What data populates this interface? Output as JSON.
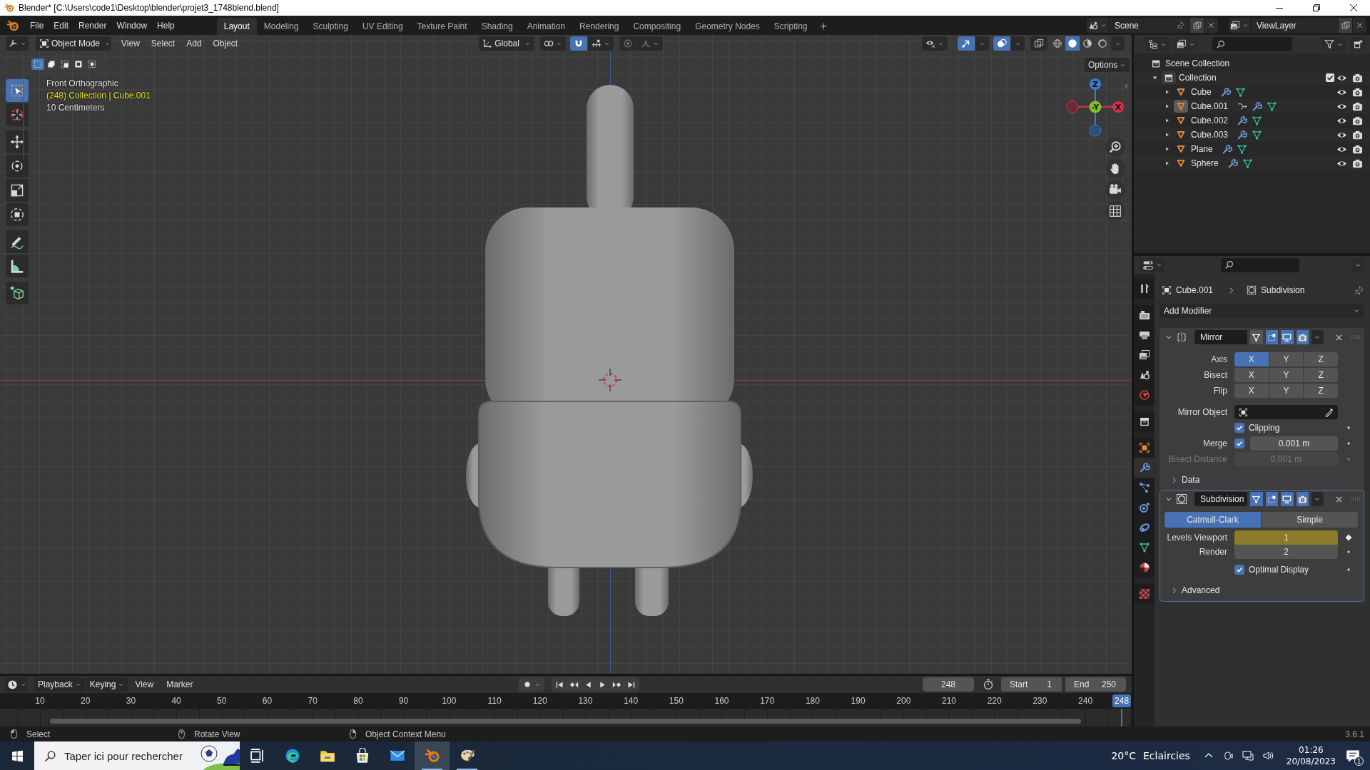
{
  "window": {
    "title": "Blender* [C:\\Users\\code1\\Desktop\\blender\\projet3_1748blend.blend]"
  },
  "menus": [
    "File",
    "Edit",
    "Render",
    "Window",
    "Help"
  ],
  "workspaces": [
    {
      "label": "Layout",
      "selected": true
    },
    {
      "label": "Modeling",
      "selected": false
    },
    {
      "label": "Sculpting",
      "selected": false
    },
    {
      "label": "UV Editing",
      "selected": false
    },
    {
      "label": "Texture Paint",
      "selected": false
    },
    {
      "label": "Shading",
      "selected": false
    },
    {
      "label": "Animation",
      "selected": false
    },
    {
      "label": "Rendering",
      "selected": false
    },
    {
      "label": "Compositing",
      "selected": false
    },
    {
      "label": "Geometry Nodes",
      "selected": false
    },
    {
      "label": "Scripting",
      "selected": false
    }
  ],
  "add_workspace": "+",
  "scene": "Scene",
  "view_layer": "ViewLayer",
  "viewport": {
    "mode": "Object Mode",
    "menus": [
      "View",
      "Select",
      "Add",
      "Object"
    ],
    "orientation": "Global",
    "snap": {
      "on": true
    },
    "gizmos": {
      "on": true
    },
    "overlays": {
      "on": true
    },
    "xray": {
      "on": false
    },
    "shading": [
      {
        "kind": "wireframe",
        "selected": false
      },
      {
        "kind": "solid",
        "selected": true
      },
      {
        "kind": "material",
        "selected": false
      },
      {
        "kind": "rendered",
        "selected": false
      }
    ],
    "select_modes": [
      {
        "selected": true
      },
      {
        "selected": false
      },
      {
        "selected": false
      },
      {
        "selected": false
      },
      {
        "selected": false
      }
    ],
    "options": "Options",
    "info": {
      "view": "Front Orthographic",
      "object": "(248) Collection | Cube.001",
      "scale": "10 Centimeters"
    },
    "tools": [
      [
        {
          "kind": "select",
          "selected": true
        },
        {
          "kind": "cursor",
          "selected": false
        }
      ],
      [
        {
          "kind": "move",
          "selected": false
        },
        {
          "kind": "rotate",
          "selected": false
        },
        {
          "kind": "scale",
          "selected": false
        },
        {
          "kind": "transform",
          "selected": false
        }
      ],
      [
        {
          "kind": "annotate",
          "selected": false
        },
        {
          "kind": "measure",
          "selected": false
        }
      ],
      [
        {
          "kind": "add-cube",
          "selected": false
        }
      ]
    ],
    "gizmo": {
      "z": "Z",
      "y": "-Y",
      "x": "X"
    }
  },
  "outliner": {
    "root": "Scene Collection",
    "collections": [
      {
        "label": "Collection",
        "expanded": true,
        "checked": true,
        "children": [
          {
            "label": "Cube",
            "selected": false,
            "expanded": false,
            "hook": false
          },
          {
            "label": "Cube.001",
            "selected": true,
            "expanded": false,
            "hook": true
          },
          {
            "label": "Cube.002",
            "selected": false,
            "expanded": false,
            "hook": false
          },
          {
            "label": "Cube.003",
            "selected": false,
            "expanded": false,
            "hook": false
          },
          {
            "label": "Plane",
            "selected": false,
            "expanded": false,
            "hook": false
          },
          {
            "label": "Sphere",
            "selected": false,
            "expanded": false,
            "hook": false
          }
        ]
      }
    ]
  },
  "properties": {
    "tabs": [
      [
        {
          "kind": "tool",
          "selected": false
        }
      ],
      [
        {
          "kind": "render",
          "selected": false
        },
        {
          "kind": "output",
          "selected": false
        },
        {
          "kind": "view-layer",
          "selected": false
        },
        {
          "kind": "scene",
          "selected": false
        },
        {
          "kind": "world",
          "selected": false
        }
      ],
      [
        {
          "kind": "collection",
          "selected": false
        }
      ],
      [
        {
          "kind": "object",
          "selected": false
        },
        {
          "kind": "modifiers",
          "selected": true
        },
        {
          "kind": "particles",
          "selected": false
        },
        {
          "kind": "physics",
          "selected": false
        },
        {
          "kind": "constraints",
          "selected": false
        },
        {
          "kind": "data",
          "selected": false
        },
        {
          "kind": "material",
          "selected": false
        }
      ],
      [
        {
          "kind": "texture",
          "selected": false
        }
      ]
    ],
    "breadcrumb": {
      "object": "Cube.001",
      "modifier": "Subdivision"
    },
    "add_modifier": "Add Modifier",
    "modifiers": [
      {
        "name": "Mirror",
        "kind": "mirror",
        "expanded": true,
        "active": false,
        "toggles": [
          {
            "kind": "on-cage",
            "on": false
          },
          {
            "kind": "edit-mode",
            "on": true
          },
          {
            "kind": "realtime",
            "on": true
          },
          {
            "kind": "render",
            "on": true
          }
        ],
        "axes": [
          {
            "label": "Axis",
            "buttons": [
              {
                "label": "X",
                "on": true
              },
              {
                "label": "Y",
                "on": false
              },
              {
                "label": "Z",
                "on": false
              }
            ]
          },
          {
            "label": "Bisect",
            "buttons": [
              {
                "label": "X",
                "on": false
              },
              {
                "label": "Y",
                "on": false
              },
              {
                "label": "Z",
                "on": false
              }
            ]
          },
          {
            "label": "Flip",
            "buttons": [
              {
                "label": "X",
                "on": false
              },
              {
                "label": "Y",
                "on": false
              },
              {
                "label": "Z",
                "on": false
              }
            ]
          }
        ],
        "mirror_object": {
          "label": "Mirror Object"
        },
        "clipping": {
          "label": "Clipping",
          "checked": true
        },
        "merge": {
          "label": "Merge",
          "checked": true,
          "value": "0.001 m"
        },
        "bisect_distance": {
          "label": "Bisect Distance",
          "value": "0.001 m",
          "disabled": true
        },
        "subpanels": [
          {
            "label": "Data",
            "expanded": false
          }
        ]
      },
      {
        "name": "Subdivision",
        "kind": "subdivision",
        "expanded": true,
        "active": true,
        "toggles": [
          {
            "kind": "on-cage",
            "on": true
          },
          {
            "kind": "edit-mode",
            "on": true
          },
          {
            "kind": "realtime",
            "on": true
          },
          {
            "kind": "render",
            "on": true
          }
        ],
        "methods": [
          {
            "label": "Catmull-Clark",
            "selected": true
          },
          {
            "label": "Simple",
            "selected": false
          }
        ],
        "levels": [
          {
            "label": "Levels Viewport",
            "value": "1",
            "keyframed": true
          },
          {
            "label": "Render",
            "value": "2",
            "keyframed": false
          }
        ],
        "optimal_display": {
          "label": "Optimal Display",
          "checked": true
        },
        "subpanels": [
          {
            "label": "Advanced",
            "expanded": false
          }
        ]
      }
    ]
  },
  "timeline": {
    "menus": [
      "Playback",
      "Keying",
      "View",
      "Marker"
    ],
    "auto_keying": {
      "on": false
    },
    "current_frame": "248",
    "start": {
      "label": "Start",
      "value": "1"
    },
    "end": {
      "label": "End",
      "value": "250"
    },
    "ticks": [
      "10",
      "20",
      "30",
      "40",
      "50",
      "60",
      "70",
      "80",
      "90",
      "100",
      "110",
      "120",
      "130",
      "140",
      "150",
      "160",
      "170",
      "180",
      "190",
      "200",
      "210",
      "220",
      "230",
      "240"
    ],
    "playhead": "248"
  },
  "status_bar": {
    "hints": [
      "Select",
      "Rotate View",
      "Object Context Menu"
    ],
    "version": "3.6.1"
  },
  "taskbar": {
    "search": {
      "placeholder": "Taper ici pour rechercher"
    },
    "apps": [
      {
        "kind": "task-view",
        "selected": false,
        "running": false
      },
      {
        "kind": "edge",
        "selected": false,
        "running": false
      },
      {
        "kind": "explorer",
        "selected": false,
        "running": false
      },
      {
        "kind": "store",
        "selected": false,
        "running": false
      },
      {
        "kind": "mail",
        "selected": false,
        "running": false
      },
      {
        "kind": "blender",
        "selected": true,
        "running": true
      },
      {
        "kind": "paint",
        "selected": false,
        "running": true
      }
    ],
    "weather": {
      "temperature": "20°C",
      "condition": "Eclaircies"
    },
    "clock": {
      "time": "01:26",
      "date": "20/08/2023"
    },
    "notifications": "1"
  }
}
